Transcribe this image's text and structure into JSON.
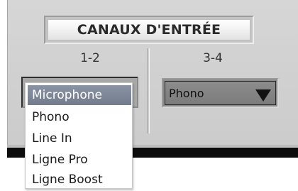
{
  "panel": {
    "title": "CANAUX D'ENTRÉE",
    "columns": [
      {
        "label": "1-2"
      },
      {
        "label": "3-4"
      }
    ]
  },
  "input_12": {
    "selected": "Microphone",
    "options": [
      "Microphone",
      "Phono",
      "Line In",
      "Ligne Pro",
      "Ligne Boost"
    ]
  },
  "input_34": {
    "selected": "Phono",
    "arrow_icon": "triangle-down-icon"
  },
  "colors": {
    "highlight": "#7d8798",
    "panel_bg": "#d2d2d2",
    "bar": "#0c0c0c"
  }
}
